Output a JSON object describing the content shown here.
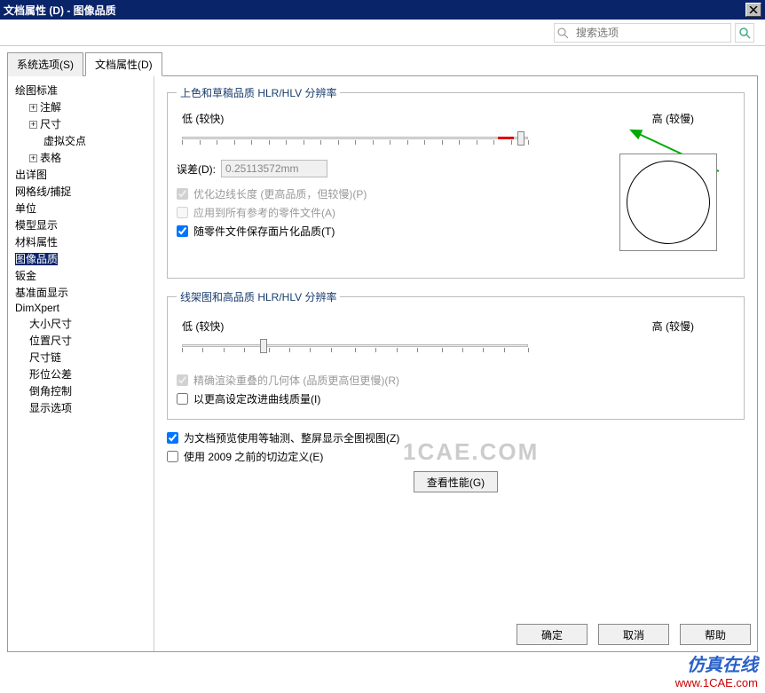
{
  "window": {
    "title": "文档属性 (D) - 图像品质"
  },
  "search": {
    "placeholder": "搜索选项"
  },
  "tabs": {
    "system": "系统选项(S)",
    "document": "文档属性(D)"
  },
  "tree": {
    "t1": "绘图标准",
    "t2": "注解",
    "t3": "尺寸",
    "t4": "虚拟交点",
    "t5": "表格",
    "t6": "出详图",
    "t7": "网格线/捕捉",
    "t8": "单位",
    "t9": "模型显示",
    "t10": "材料属性",
    "t11": "图像品质",
    "t12": "钣金",
    "t13": "基准面显示",
    "t14": "DimXpert",
    "t15": "大小尺寸",
    "t16": "位置尺寸",
    "t17": "尺寸链",
    "t18": "形位公差",
    "t19": "倒角控制",
    "t20": "显示选项"
  },
  "group1": {
    "legend": "上色和草稿品质 HLR/HLV 分辨率",
    "low": "低 (较快)",
    "high": "高 (较慢)",
    "err_label": "误差(D):",
    "err_value": "0.25113572mm",
    "c1": "优化边线长度 (更高品质，但较慢)(P)",
    "c2": "应用到所有参考的零件文件(A)",
    "c3": "随零件文件保存面片化品质(T)"
  },
  "group2": {
    "legend": "线架图和高品质 HLR/HLV 分辨率",
    "low": "低 (较快)",
    "high": "高 (较慢)",
    "c1": "精确渲染重叠的几何体 (品质更高但更慢)(R)",
    "c2": "以更高设定改进曲线质量(I)"
  },
  "c_global1": "为文档预览使用等轴测、整屏显示全图视图(Z)",
  "c_global2": "使用 2009 之前的切边定义(E)",
  "perf_btn": "查看性能(G)",
  "buttons": {
    "ok": "确定",
    "cancel": "取消",
    "help": "帮助"
  },
  "watermarks": {
    "center": "1CAE.COM",
    "brand": "仿真在线",
    "url": "www.1CAE.com"
  }
}
